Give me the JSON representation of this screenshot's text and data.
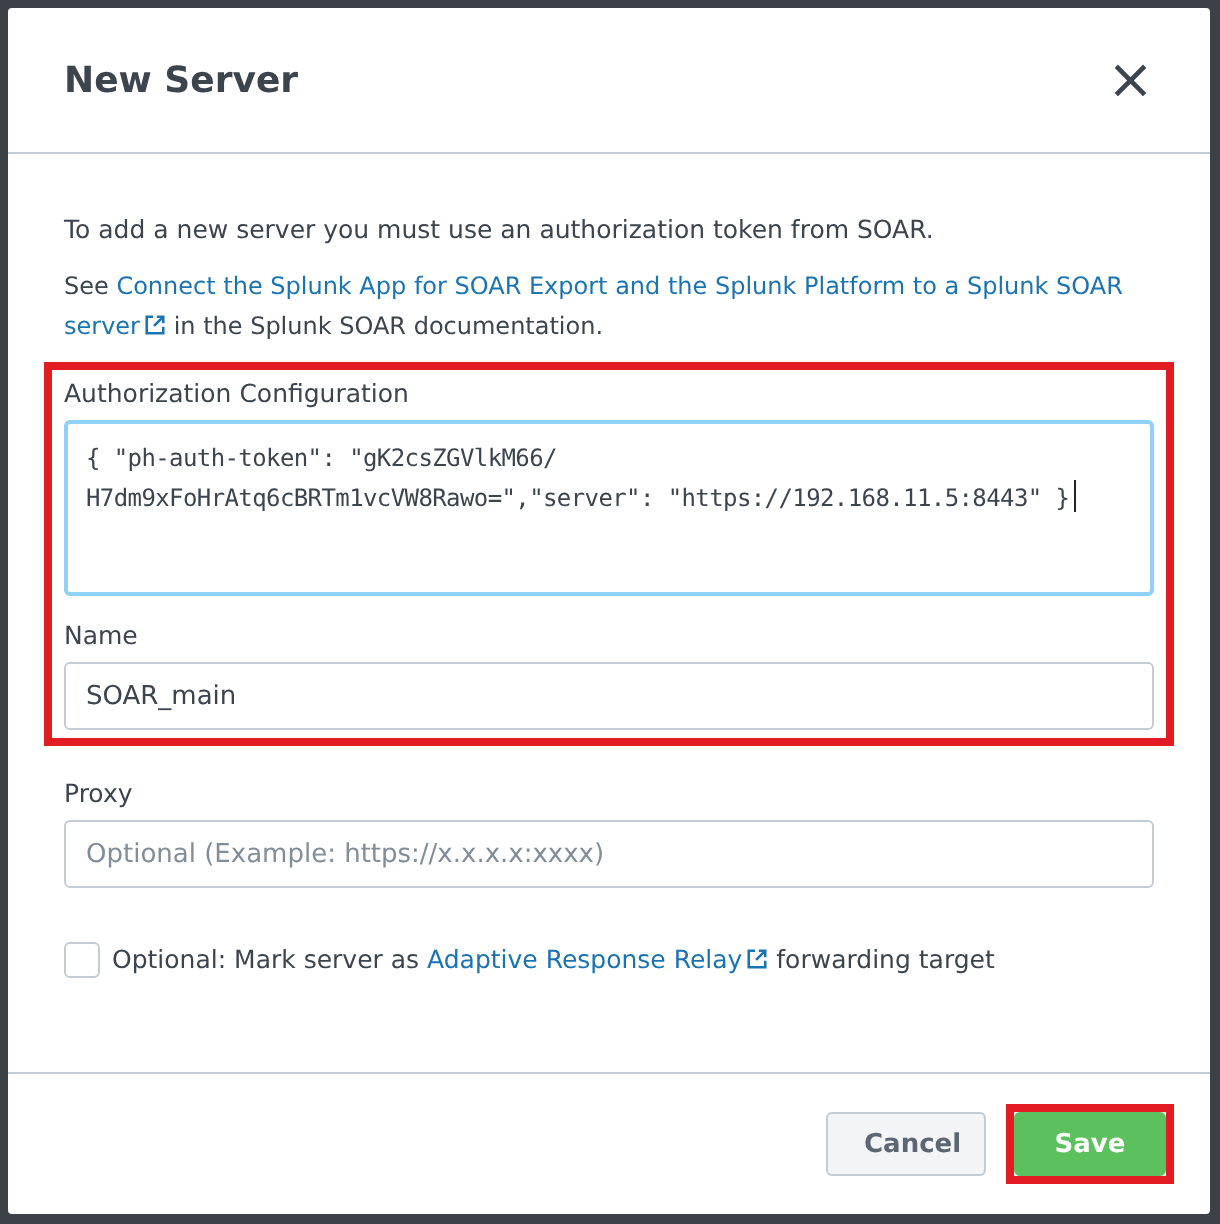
{
  "dialog": {
    "title": "New Server",
    "close": "×"
  },
  "intro": "To add a new server you must use an authorization token from SOAR.",
  "doc_note": {
    "before": "See ",
    "link_lines": [
      "Connect the Splunk App for SOAR Export and the Splunk Platform to a Splunk SOAR",
      "server"
    ],
    "after": " in the Splunk SOAR documentation."
  },
  "highlight_group": {
    "highlighted": true
  },
  "auth_field": {
    "label": "Authorization Configuration",
    "value_lines": [
      "{ \"ph-auth-token\": \"gK2csZGVlkM66/",
      "H7dm9xFoHrAtq6cBRTm1vcVW8Rawo=\",\"server\": \"https://192.168.11.5:8443\" }"
    ],
    "focused": true
  },
  "name_field": {
    "label": "Name",
    "value": "SOAR_main"
  },
  "proxy_field": {
    "label": "Proxy",
    "placeholder": "Optional (Example: https://x.x.x.x:xxxx)"
  },
  "relay_option": {
    "checked": false,
    "before": "Optional: Mark server as ",
    "link": "Adaptive Response Relay",
    "after": " forwarding target"
  },
  "buttons": [
    {
      "label": "Cancel",
      "kind": "secondary",
      "highlighted": false
    },
    {
      "label": "Save",
      "kind": "primary",
      "highlighted": true
    }
  ]
}
